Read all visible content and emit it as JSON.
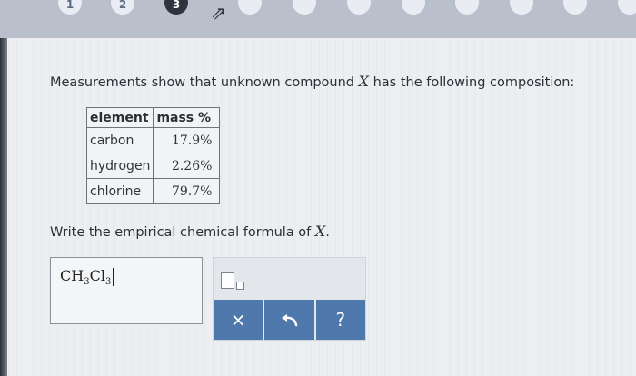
{
  "nav": {
    "steps": [
      "1",
      "2",
      "3",
      "",
      "",
      "",
      "",
      "",
      "",
      "",
      "",
      ""
    ],
    "active_index": 2
  },
  "prompt": {
    "before": "Measurements show that unknown compound",
    "variable": "X",
    "after": "has the following composition:"
  },
  "table": {
    "headers": [
      "element",
      "mass %"
    ],
    "rows": [
      {
        "element": "carbon",
        "mass": "17.9%"
      },
      {
        "element": "hydrogen",
        "mass": "2.26%"
      },
      {
        "element": "chlorine",
        "mass": "79.7%"
      }
    ]
  },
  "question": {
    "before": "Write the empirical chemical formula of",
    "variable": "X",
    "after": "."
  },
  "answer": {
    "parts": [
      {
        "sym": "CH",
        "sub": "3"
      },
      {
        "sym": "Cl",
        "sub": "3"
      }
    ]
  },
  "tools": {
    "subscript_icon": "subscript-template-icon",
    "clear_label": "×",
    "undo_icon": "undo-arrow-icon",
    "help_label": "?"
  },
  "colors": {
    "button_bar": "#4f78ad",
    "active_step": "#2d3440"
  }
}
